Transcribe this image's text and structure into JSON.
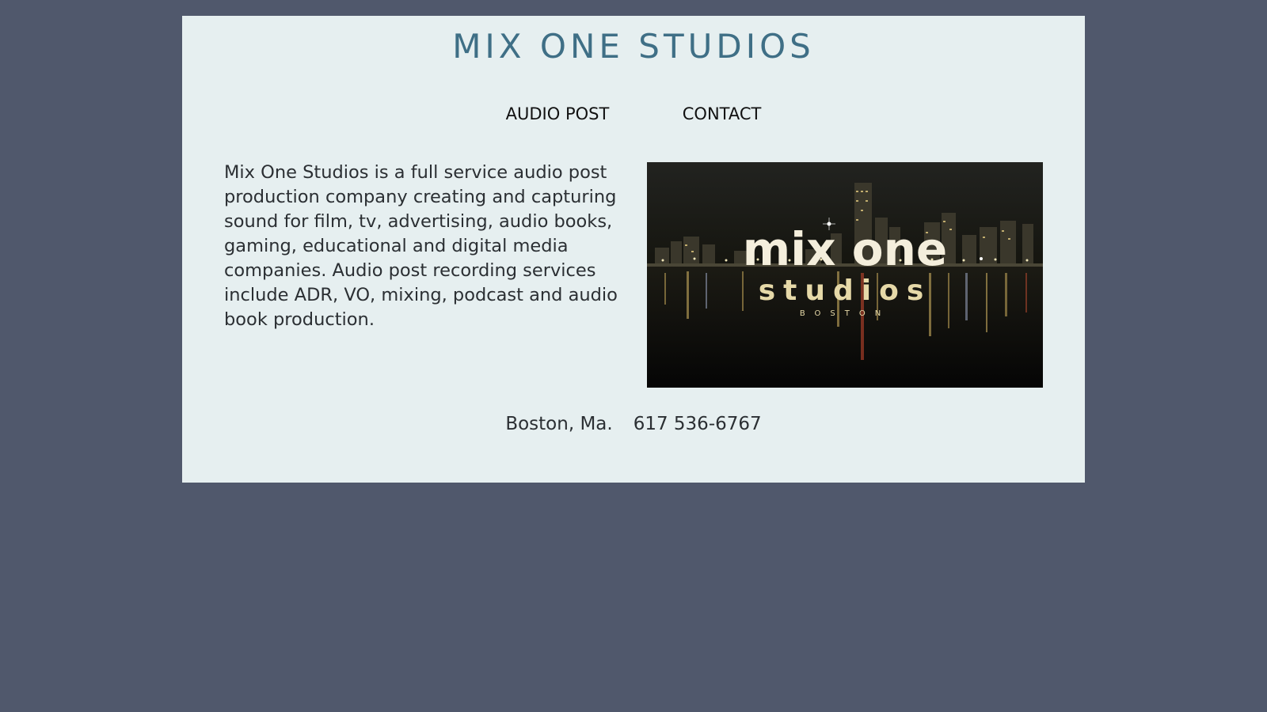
{
  "header": {
    "title": "MIX ONE STUDIOS"
  },
  "nav": {
    "items": [
      {
        "label": "AUDIO POST"
      },
      {
        "label": "CONTACT"
      }
    ]
  },
  "intro": {
    "text": "Mix One Studios is a full service audio post production company creating and capturing sound for film, tv, advertising, audio books, gaming, educational and digital media companies. Audio post recording services include ADR, VO, mixing, podcast and audio book production."
  },
  "hero": {
    "logo_line1": "mix one",
    "logo_line2": "studios",
    "logo_line3": "BOSTON"
  },
  "footer": {
    "location": "Boston, Ma.",
    "phone": "617 536-6767"
  },
  "colors": {
    "background": "#50586c",
    "panel": "#e6eff0",
    "title": "#3f6f86",
    "body_text": "#2b2f33"
  }
}
